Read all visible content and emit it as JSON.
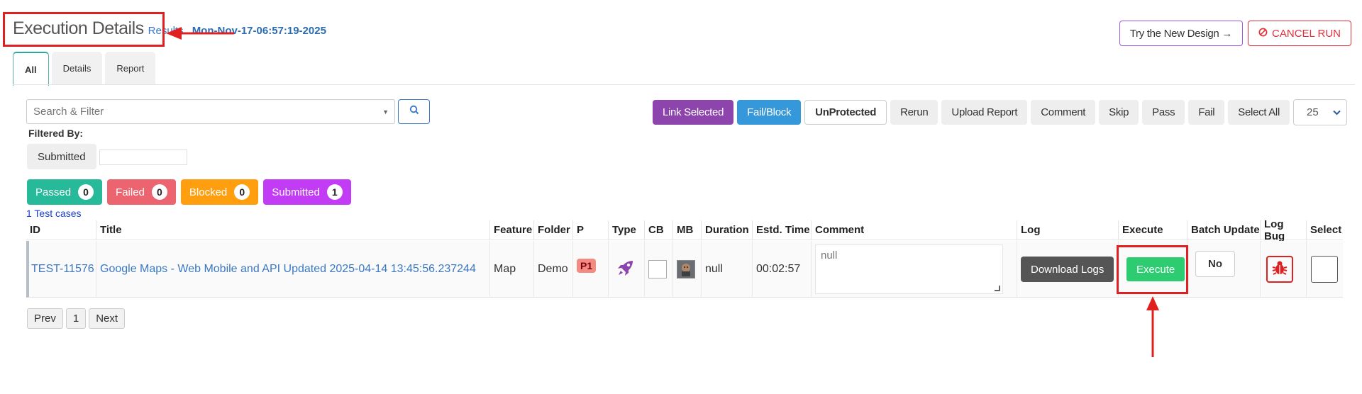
{
  "header": {
    "title": "Execution Details",
    "results_link": "Results",
    "run_date": "Mon-Nov-17-06:57:19-2025"
  },
  "top_actions": {
    "try_new_design": "Try the New Design →",
    "cancel_run": "CANCEL RUN"
  },
  "tabs": [
    {
      "label": "All",
      "active": true
    },
    {
      "label": "Details",
      "active": false
    },
    {
      "label": "Report",
      "active": false
    }
  ],
  "search": {
    "placeholder": "Search & Filter"
  },
  "action_bar": {
    "buttons": [
      "Link Selected",
      "Fail/Block",
      "UnProtected",
      "Rerun",
      "Upload Report",
      "Comment",
      "Skip",
      "Pass",
      "Fail",
      "Select All"
    ],
    "page_size": "25"
  },
  "filters": {
    "label": "Filtered By:",
    "chip": "Submitted"
  },
  "status_counts": [
    {
      "label": "Passed",
      "count": "0",
      "color": "#26b99a"
    },
    {
      "label": "Failed",
      "count": "0",
      "color": "#ec6470"
    },
    {
      "label": "Blocked",
      "count": "0",
      "color": "#ff9f0f"
    },
    {
      "label": "Submitted",
      "count": "1",
      "color": "#c33cf5"
    }
  ],
  "test_case_count": "1 Test cases",
  "table": {
    "columns": [
      "ID",
      "Title",
      "Feature",
      "Folder",
      "P",
      "Type",
      "CB",
      "MB",
      "Duration",
      "Estd. Time",
      "Comment",
      "Log",
      "Execute",
      "Batch Update",
      "Log Bug",
      "Select"
    ],
    "rows": [
      {
        "id": "TEST-11576",
        "title": "Google Maps - Web Mobile and API Updated 2025-04-14 13:45:56.237244",
        "feature": "Map",
        "folder": "Demo",
        "priority": "P1",
        "type_icon": "rocket-icon",
        "duration": "null",
        "estd_time": "00:02:57",
        "comment": "null",
        "log_button": "Download Logs",
        "execute_button": "Execute",
        "batch_update": "No"
      }
    ]
  },
  "pagination": {
    "prev": "Prev",
    "page": "1",
    "next": "Next"
  }
}
